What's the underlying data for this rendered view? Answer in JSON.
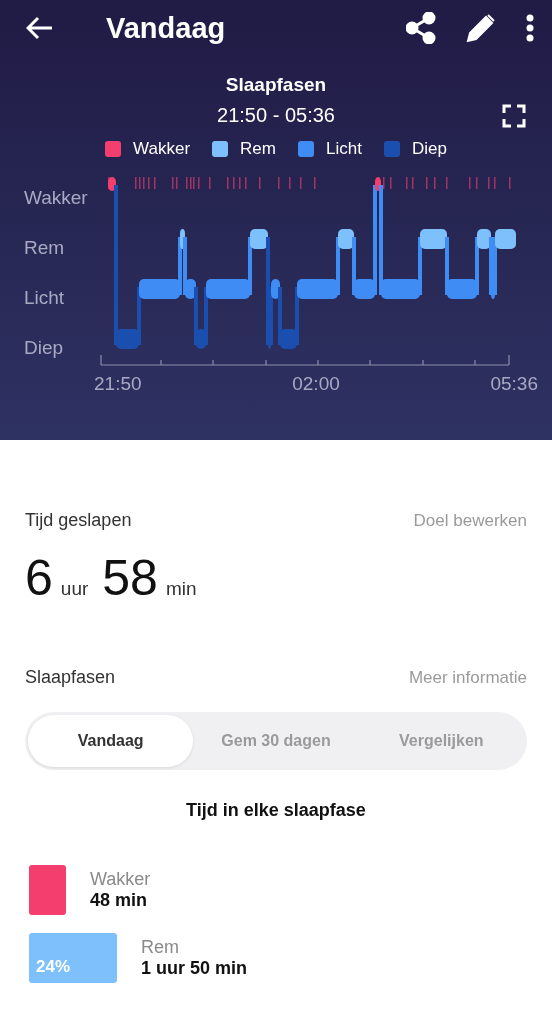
{
  "app_bar": {
    "title": "Vandaag"
  },
  "chart": {
    "title": "Slaapfasen",
    "time_range": "21:50 - 05:36",
    "legend": [
      {
        "label": "Wakker",
        "color": "#f43f6e"
      },
      {
        "label": "Rem",
        "color": "#7ec0fb"
      },
      {
        "label": "Licht",
        "color": "#3f8cf5"
      },
      {
        "label": "Diep",
        "color": "#1a4fb0"
      }
    ],
    "y_labels": [
      "Wakker",
      "Rem",
      "Licht",
      "Diep"
    ],
    "x_labels": [
      "21:50",
      "02:00",
      "05:36"
    ]
  },
  "sleep_time": {
    "label": "Tijd geslapen",
    "link": "Doel bewerken",
    "parts": [
      {
        "number": "6",
        "unit": "uur"
      },
      {
        "number": "58",
        "unit": "min"
      }
    ]
  },
  "stages_section": {
    "label": "Slaapfasen",
    "link": "Meer informatie"
  },
  "segments": [
    {
      "label": "Vandaag",
      "selected": true
    },
    {
      "label": "Gem 30 dagen",
      "selected": false
    },
    {
      "label": "Vergelijken",
      "selected": false
    }
  ],
  "stages_heading": "Tijd in elke slaapfase",
  "stages": [
    {
      "name": "Wakker",
      "duration": "48 min",
      "color": "#f43f6e"
    },
    {
      "name": "Rem",
      "duration": "1 uur 50 min",
      "color": "#7ec0fb",
      "percent": "24%"
    }
  ]
}
